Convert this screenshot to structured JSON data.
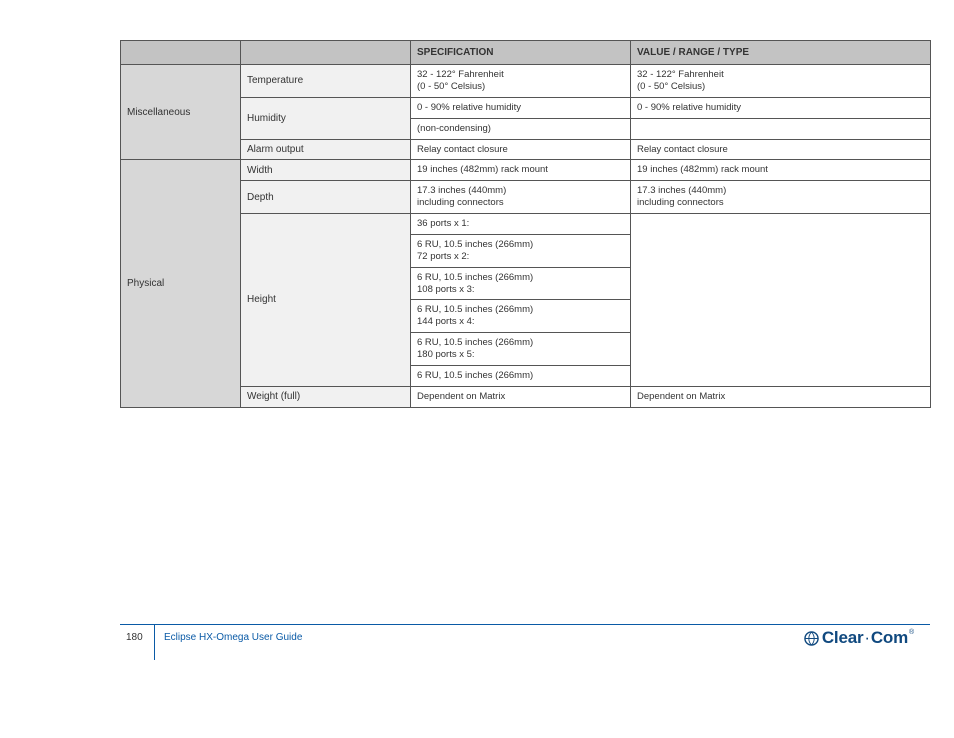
{
  "header": {
    "cols": [
      "",
      "",
      "SPECIFICATION",
      "VALUE / RANGE / TYPE"
    ]
  },
  "rows": [
    {
      "cat": "Miscellaneous",
      "catRowspan": 4,
      "sub": "Temperature",
      "spec": "",
      "specHtml": "32 - 122&deg; Fahrenheit<br>(0 - 50&deg; Celsius)",
      "val": "",
      "valHtml": "32 - 122&deg; Fahrenheit<br>(0 - 50&deg; Celsius)"
    },
    {
      "sub": "Humidity",
      "subRowspan": 2,
      "spec": "0 - 90% relative humidity",
      "val": "0 - 90% relative humidity"
    },
    {
      "spec": "(non-condensing)",
      "val": ""
    },
    {
      "sub": "Alarm output",
      "spec": "Relay contact closure",
      "val": "Relay contact closure"
    },
    {
      "cat": "Physical",
      "catRowspan": 9,
      "sub": "Width",
      "spec": "19 inches (482mm) rack mount",
      "val": "19 inches (482mm) rack mount"
    },
    {
      "sub": "Depth",
      "specHtml": "17.3 inches (440mm)<br>including connectors",
      "valHtml": "17.3 inches (440mm)<br>including connectors"
    },
    {
      "sub": "Height",
      "subRowspan": 6,
      "spec": "36 ports x 1:",
      "val": "",
      "valRowspan": 6
    },
    {
      "spec": "",
      "specHtml": "6 RU, 10.5 inches (266mm)<br>72 ports x 2:"
    },
    {
      "spec": "",
      "specHtml": "6 RU, 10.5 inches (266mm)<br>108 ports x 3:"
    },
    {
      "spec": "",
      "specHtml": "6 RU, 10.5 inches (266mm)<br>144 ports x 4:"
    },
    {
      "spec": "",
      "specHtml": "6 RU, 10.5 inches (266mm)<br>180 ports x 5:"
    },
    {
      "spec": "6 RU, 10.5 inches (266mm)"
    },
    {
      "sub": "Weight (full)",
      "spec": "Dependent on Matrix",
      "val": "Dependent on Matrix"
    }
  ],
  "footer": {
    "page": "180",
    "caption": "Eclipse HX-Omega User Guide",
    "brand": {
      "a": "Clear",
      "b": "Com"
    }
  }
}
